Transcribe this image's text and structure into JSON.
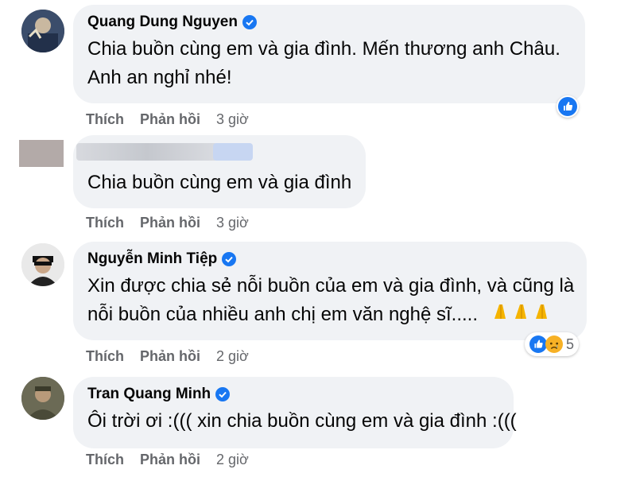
{
  "comments": [
    {
      "author": "Quang Dung Nguyen",
      "lines": [
        "Chia buồn cùng em và gia đình. Mến thương anh Châu.",
        "Anh an nghỉ nhé!"
      ],
      "like": "Thích",
      "reply": "Phản hồi",
      "time": "3 giờ",
      "reactions": [
        "like"
      ]
    },
    {
      "author": "",
      "lines": [
        "Chia buồn cùng em và gia đình"
      ],
      "like": "Thích",
      "reply": "Phản hồi",
      "time": "3 giờ"
    },
    {
      "author": "Nguyễn Minh Tiệp",
      "lines": [
        "Xin được chia sẻ nỗi buồn của em và gia đình, và cũng là",
        "nỗi buồn của nhiều anh chị em văn nghệ sĩ....."
      ],
      "like": "Thích",
      "reply": "Phản hồi",
      "time": "2 giờ",
      "reactions": [
        "like",
        "sad"
      ],
      "reaction_count": "5"
    },
    {
      "author": "Tran Quang Minh",
      "lines": [
        "Ôi trời ơi :((( xin chia buồn cùng em và gia đình :((("
      ],
      "like": "Thích",
      "reply": "Phản hồi",
      "time": "2 giờ"
    }
  ],
  "colors": {
    "bubble": "#f0f2f5",
    "accent": "#1877f2",
    "meta": "#65676b"
  }
}
